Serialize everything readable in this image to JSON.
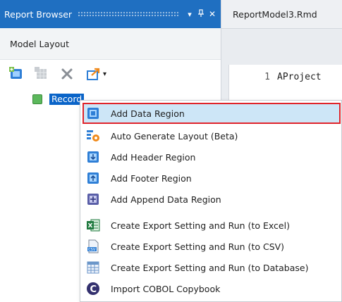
{
  "panel": {
    "title": "Report Browser",
    "dropdown_glyph": "▾",
    "pin_glyph": "ᵖ",
    "close_glyph": "✕",
    "section_label": "Model Layout"
  },
  "toolbar": {
    "icons": [
      "add-region-icon",
      "grid-disabled-icon",
      "delete-icon",
      "export-icon"
    ],
    "export_dropdown_glyph": "▾"
  },
  "tree": {
    "node_label": "Record"
  },
  "editor": {
    "tab_label": "ReportModel3.Rmd",
    "line_number": "1",
    "code_text": "AProject"
  },
  "context_menu": {
    "items": [
      {
        "label": "Add Data Region",
        "icon": "data-region-icon"
      },
      {
        "label": "Auto Generate Layout (Beta)",
        "icon": "auto-generate-icon"
      },
      {
        "label": "Add Header Region",
        "icon": "header-region-icon"
      },
      {
        "label": "Add Footer Region",
        "icon": "footer-region-icon"
      },
      {
        "label": "Add Append Data Region",
        "icon": "append-region-icon"
      },
      {
        "label": "Create Export Setting and Run (to Excel)",
        "icon": "excel-icon"
      },
      {
        "label": "Create Export Setting and Run (to CSV)",
        "icon": "csv-icon"
      },
      {
        "label": "Create Export Setting and Run (to Database)",
        "icon": "database-icon"
      },
      {
        "label": "Import COBOL Copybook",
        "icon": "cobol-icon"
      }
    ]
  },
  "colors": {
    "title_bar": "#1f6fc1",
    "selection": "#0a64c8",
    "menu_highlight": "#cde6f7",
    "highlight_border": "#e0242a"
  }
}
